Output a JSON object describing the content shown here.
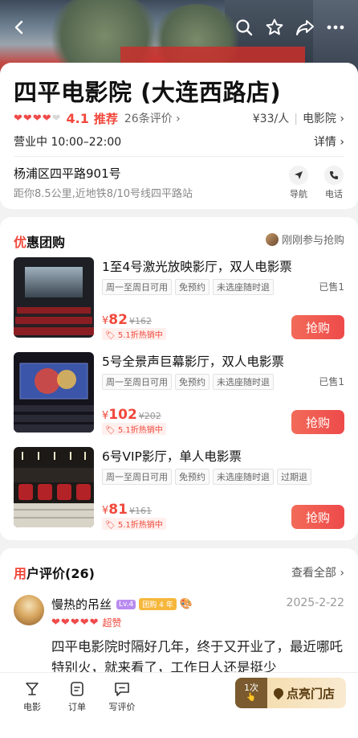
{
  "header": {
    "back_icon": "back-arrow-icon",
    "actions": [
      "search-icon",
      "star-icon",
      "share-icon",
      "more-icon"
    ]
  },
  "shop": {
    "name": "四平电影院 (大连西路店)",
    "rating_hearts": 4,
    "rating_max": 5,
    "score": "4.1",
    "recommend": "推荐",
    "reviews": "26条评价",
    "price": "¥33/人",
    "category": "电影院",
    "hours": "营业中 10:00–22:00",
    "detail": "详情",
    "address": "杨浦区四平路901号",
    "distance": "距你8.5公里,近地铁8/10号线四平路站",
    "nav_label": "导航",
    "call_label": "电话"
  },
  "deals": {
    "title_first": "优",
    "title_rest": "惠团购",
    "joined": "刚刚参与抢购",
    "items": [
      {
        "name": "1至4号激光放映影厅，双人电影票",
        "chips": [
          "周一至周日可用",
          "免预约",
          "未选座随时退"
        ],
        "sold": "已售1",
        "price": "82",
        "old_price": "¥162",
        "hot": "5.1折热销中",
        "buy": "抢购"
      },
      {
        "name": "5号全景声巨幕影厅，双人电影票",
        "chips": [
          "周一至周日可用",
          "免预约",
          "未选座随时退"
        ],
        "sold": "已售1",
        "price": "102",
        "old_price": "¥202",
        "hot": "5.1折热销中",
        "buy": "抢购"
      },
      {
        "name": "6号VIP影厅，单人电影票",
        "chips": [
          "周一至周日可用",
          "免预约",
          "未选座随时退",
          "过期退"
        ],
        "sold": "",
        "price": "81",
        "old_price": "¥161",
        "hot": "5.1折热销中",
        "buy": "抢购"
      }
    ],
    "currency": "¥"
  },
  "reviews_section": {
    "title_first": "用",
    "title_rest": "户评价(26)",
    "see_all": "查看全部",
    "review": {
      "user": "慢热的吊丝",
      "level": "Lv.4",
      "group_badge": "团购 4 年",
      "date": "2025-2-22",
      "hearts": 5,
      "tag": "超赞",
      "text": "四平电影院时隔好几年，终于又开业了，最近哪吒特别火，就来看了，工作日人还是挺少"
    }
  },
  "bottom": {
    "tabs": [
      {
        "icon": "movie-icon",
        "label": "电影"
      },
      {
        "icon": "order-icon",
        "label": "订单"
      },
      {
        "icon": "write-review-icon",
        "label": "写评价"
      }
    ],
    "light_count": "1次",
    "light_label": "点亮门店"
  }
}
